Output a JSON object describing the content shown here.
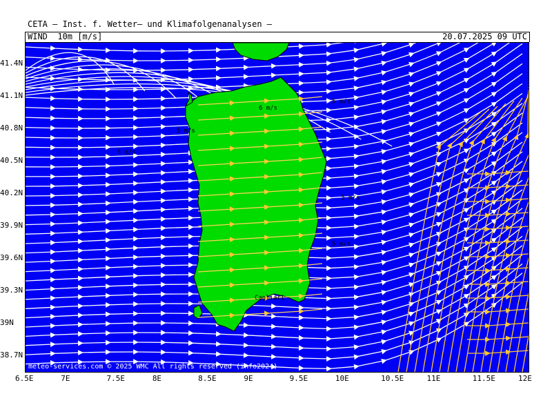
{
  "header": {
    "title": "CETA – Inst. f. Wetter– und Klimafolgenanalysen –",
    "variable": "WIND  10m [m/s]",
    "timestamp": "20.07.2025 09 UTC"
  },
  "map": {
    "lon_ticks": [
      "6.5E",
      "7E",
      "7.5E",
      "8E",
      "8.5E",
      "9E",
      "9.5E",
      "10E",
      "10.5E",
      "11E",
      "11.5E",
      "12E"
    ],
    "lat_ticks": [
      "41.4N",
      "41.1N",
      "40.8N",
      "40.5N",
      "40.2N",
      "39.9N",
      "39.6N",
      "39.3N",
      "39N",
      "38.7N"
    ],
    "lon_values": [
      6.5,
      7,
      7.5,
      8,
      8.5,
      9,
      9.5,
      10,
      10.5,
      11,
      11.5,
      12
    ],
    "lat_values": [
      41.4,
      41.1,
      40.8,
      40.5,
      40.2,
      39.9,
      39.6,
      39.3,
      39.0,
      38.7
    ],
    "contour_labels": [
      {
        "text": "6 m/s",
        "lon": 9.05,
        "lat": 40.98
      },
      {
        "text": "5 m/s",
        "lon": 8.15,
        "lat": 40.77
      },
      {
        "text": "5 m/s",
        "lon": 7.5,
        "lat": 40.57
      },
      {
        "text": "5 m/s",
        "lon": 9.85,
        "lat": 41.04
      },
      {
        "text": "5 m/s",
        "lon": 9.95,
        "lat": 40.15
      },
      {
        "text": "5 m/s",
        "lon": 9.85,
        "lat": 39.72
      }
    ],
    "city": {
      "name": "Cagliari",
      "lon": 9.11,
      "lat": 39.22
    },
    "copyright": "meteo-services.com © 2025 WMC All rights reserved (info2024)",
    "colors": {
      "sea": "#0000f5",
      "land": "#00dc00",
      "streamline_light": "#ffffff",
      "streamline_strong": "#ffc832"
    }
  }
}
